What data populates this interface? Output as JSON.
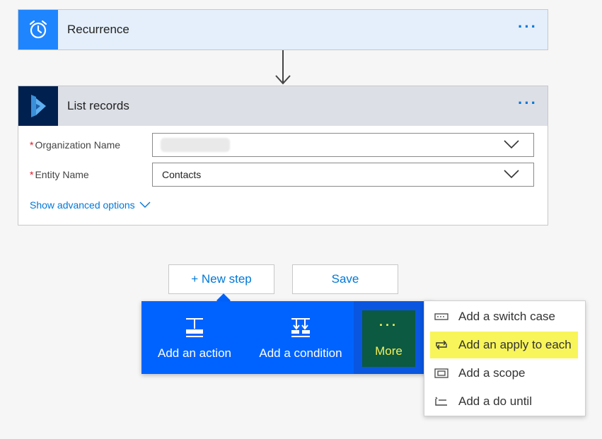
{
  "recurrence": {
    "title": "Recurrence",
    "more": "···"
  },
  "list_records": {
    "title": "List records",
    "more": "···",
    "fields": [
      {
        "label": "Organization Name",
        "required_mark": "*",
        "value": ""
      },
      {
        "label": "Entity Name",
        "required_mark": "*",
        "value": "Contacts"
      }
    ],
    "advanced_label": "Show advanced options"
  },
  "buttons": {
    "new_step": "+ New step",
    "save": "Save"
  },
  "action_bar": {
    "add_action": "Add an action",
    "add_condition": "Add a condition",
    "more_dots": "···",
    "more": "More"
  },
  "menu": {
    "items": [
      {
        "label": "Add a switch case",
        "icon": "switch-icon"
      },
      {
        "label": "Add an apply to each",
        "icon": "loop-icon",
        "highlighted": true
      },
      {
        "label": "Add a scope",
        "icon": "scope-icon"
      },
      {
        "label": "Add a do until",
        "icon": "do-until-icon"
      }
    ]
  },
  "colors": {
    "accent": "#0078d7",
    "action_bar": "#0063ff",
    "more_bg": "#0b5a41",
    "highlight": "#f8f55a"
  }
}
